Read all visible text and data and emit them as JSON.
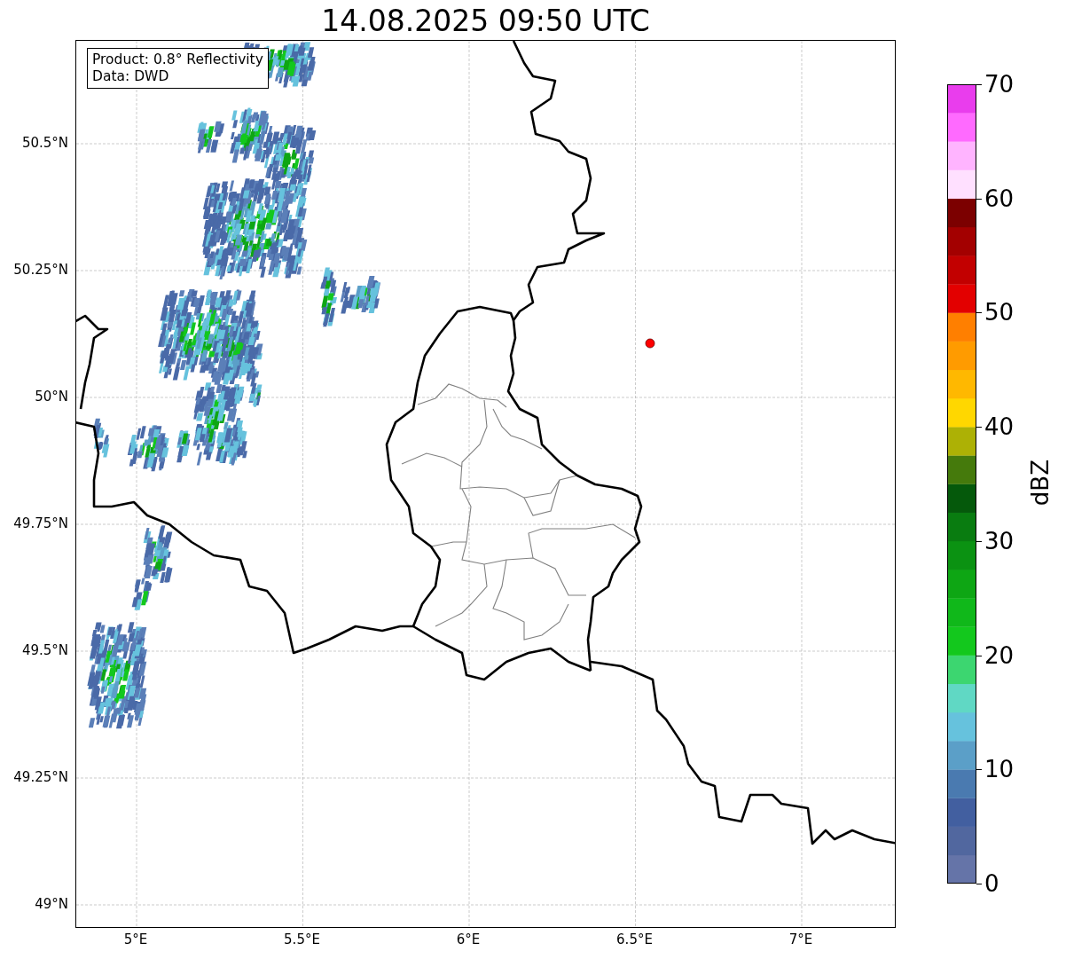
{
  "title": "14.08.2025 09:50 UTC",
  "legend": {
    "lines": [
      "Product: 0.8° Reflectivity",
      "Data: DWD"
    ]
  },
  "map": {
    "x_ticks": [
      "5°E",
      "5.5°E",
      "6°E",
      "6.5°E",
      "7°E"
    ],
    "y_ticks": [
      "50.5°N",
      "50.25°N",
      "50°N",
      "49.75°N",
      "49.5°N",
      "49.25°N",
      "49°N"
    ]
  },
  "colorbar": {
    "label": "dBZ",
    "ticks": [
      "70",
      "60",
      "50",
      "40",
      "30",
      "20",
      "10",
      "0"
    ],
    "bands": [
      {
        "color": "#6574a8"
      },
      {
        "color": "#51679f"
      },
      {
        "color": "#425fa0"
      },
      {
        "color": "#4a7ab0"
      },
      {
        "color": "#5b9fc8"
      },
      {
        "color": "#66c2dd"
      },
      {
        "color": "#60d8c4"
      },
      {
        "color": "#3cd670"
      },
      {
        "color": "#13c81d"
      },
      {
        "color": "#10b81a"
      },
      {
        "color": "#0ea614"
      },
      {
        "color": "#0b9212"
      },
      {
        "color": "#097c10"
      },
      {
        "color": "#05590b"
      },
      {
        "color": "#457a0c"
      },
      {
        "color": "#adb105"
      },
      {
        "color": "#ffd700"
      },
      {
        "color": "#ffb800"
      },
      {
        "color": "#ff9b00"
      },
      {
        "color": "#ff7f00"
      },
      {
        "color": "#e30000"
      },
      {
        "color": "#c20000"
      },
      {
        "color": "#a30000"
      },
      {
        "color": "#7c0000"
      },
      {
        "color": "#ffe0ff"
      },
      {
        "color": "#ffb4ff"
      },
      {
        "color": "#ff6aff"
      },
      {
        "color": "#e93ded"
      }
    ]
  }
}
